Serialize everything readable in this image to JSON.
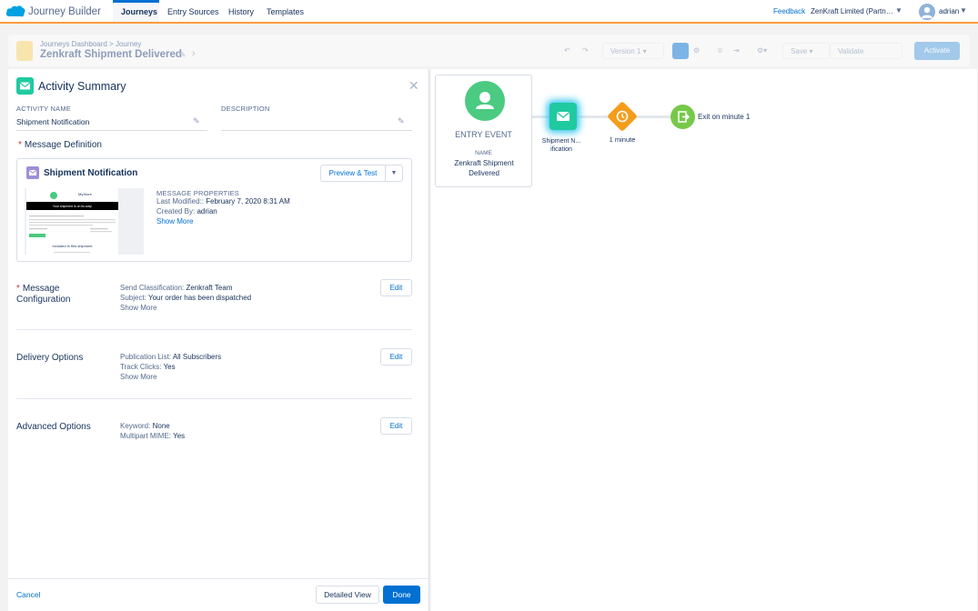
{
  "app": {
    "name": "Journey Builder",
    "tabs": [
      {
        "label": "Journeys"
      },
      {
        "label": "Entry Sources"
      },
      {
        "label": "History"
      },
      {
        "label": "Templates"
      }
    ],
    "feedback": "Feedback",
    "org": "ZenKraft Limited (Partn…",
    "user": "adrian"
  },
  "journey": {
    "breadcrumb": "Journeys Dashboard > Journey",
    "title": "Zenkraft Shipment Delivered",
    "version": "Version 1",
    "save": "Save",
    "validate": "Validate",
    "activate": "Activate"
  },
  "canvas": {
    "entry_label": "ENTRY EVENT",
    "entry_name_label": "NAME",
    "entry_name": "Zenkraft Shipment Delivered",
    "email_node_label": "Shipment N... ification",
    "wait_label": "1 minute",
    "exit_label": "Exit on minute 1"
  },
  "summary": {
    "title": "Activity Summary",
    "activity_name_label": "ACTIVITY NAME",
    "activity_name": "Shipment Notification",
    "description_label": "DESCRIPTION",
    "message_definition": "Message Definition",
    "message": {
      "name": "Shipment Notification",
      "preview_label": "Preview & Test",
      "props_heading": "MESSAGE PROPERTIES",
      "last_modified_label": "Last Modified::",
      "last_modified": "February 7, 2020 8:31 AM",
      "created_by_label": "Created By:",
      "created_by": "adrian",
      "show_more": "Show More",
      "thumb_brand": "MyStore",
      "thumb_heading": "Your shipment is on its way!",
      "thumb_included": "Included in this shipment"
    },
    "config": {
      "title": "Message Configuration",
      "send_class_label": "Send Classification:",
      "send_class": "Zenkraft Team",
      "subject_label": "Subject:",
      "subject": "Your order has been dispatched",
      "show_more": "Show More",
      "edit": "Edit"
    },
    "delivery": {
      "title": "Delivery Options",
      "pub_list_label": "Publication List:",
      "pub_list": "All Subscribers",
      "track_label": "Track Clicks:",
      "track": "Yes",
      "show_more": "Show More",
      "edit": "Edit"
    },
    "advanced": {
      "title": "Advanced Options",
      "keyword_label": "Keyword:",
      "keyword": "None",
      "mime_label": "Multipart MIME:",
      "mime": "Yes",
      "edit": "Edit"
    },
    "footer": {
      "cancel": "Cancel",
      "detailed_view": "Detailed View",
      "done": "Done"
    }
  },
  "colors": {
    "brand": "#0070d2",
    "accent_orange": "#ff9a3c",
    "email_green": "#1fcaa0",
    "entry_green": "#4bca81",
    "wait_orange": "#f49d1c",
    "exit_green": "#78c84a"
  }
}
